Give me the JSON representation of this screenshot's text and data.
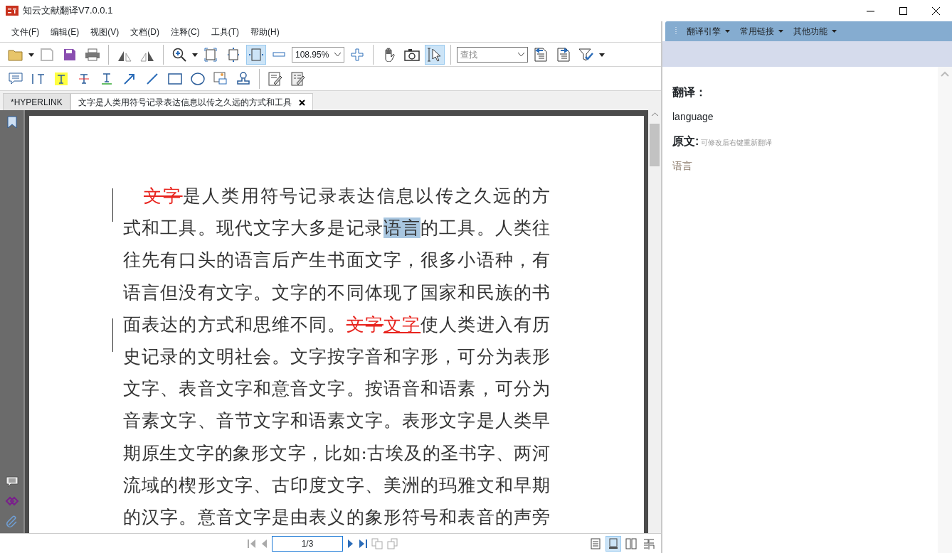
{
  "window": {
    "title": "知云文献翻译V7.0.0.1"
  },
  "menu": [
    "文件(F)",
    "编辑(E)",
    "视图(V)",
    "文档(D)",
    "注释(C)",
    "工具(T)",
    "帮助(H)"
  ],
  "toolbar": {
    "zoom_value": "108.95%",
    "search_placeholder": "查找",
    "fit_width_selected": true,
    "select_tool_selected": true
  },
  "tabs": [
    {
      "label": "*HYPERLINK",
      "selected": false,
      "closable": false
    },
    {
      "label": "文字是人类用符号记录表达信息以传之久远的方式和工具",
      "selected": true,
      "closable": true
    }
  ],
  "document": {
    "lines": [
      [
        {
          "text": "文字",
          "kind": "strike"
        },
        {
          "text": "是人类用符号记录表达信息以传之久远的方",
          "kind": "plain"
        }
      ],
      [
        {
          "text": "式和工具。现代文字大多是记录",
          "kind": "plain"
        },
        {
          "text": "语言",
          "kind": "highlight"
        },
        {
          "text": "的工具。人类往",
          "kind": "plain"
        }
      ],
      [
        {
          "text": "往先有口头的语言后产生书面文字，很多小语种，有",
          "kind": "plain"
        }
      ],
      [
        {
          "text": "语言但没有文字。文字的不同体现了国家和民族的书",
          "kind": "plain"
        }
      ],
      [
        {
          "text": "面表达的方式和思维不同。",
          "kind": "plain"
        },
        {
          "text": "文字",
          "kind": "strike"
        },
        {
          "text": "文字",
          "kind": "underline"
        },
        {
          "text": "使人类进入有历",
          "kind": "plain"
        }
      ],
      [
        {
          "text": "史记录的文明社会。文字按字音和字形，可分为表形",
          "kind": "plain"
        }
      ],
      [
        {
          "text": "文字、表音文字和意音文字。按语音和语素，可分为",
          "kind": "plain"
        }
      ],
      [
        {
          "text": "音素文字、音节文字和语素文字。表形文字是人类早",
          "kind": "plain"
        }
      ],
      [
        {
          "text": "期原生文字的象形文字，比如:古埃及的圣书字、两河",
          "kind": "plain"
        }
      ],
      [
        {
          "text": "流域的楔形文字、古印度文字、美洲的玛雅文和早期",
          "kind": "plain"
        }
      ],
      [
        {
          "text": "的汉字。意音文字是由表义的象形符号和表音的声旁",
          "kind": "plain"
        }
      ]
    ]
  },
  "pager": {
    "page": "1/3"
  },
  "view_modes": [
    {
      "selected": false
    },
    {
      "selected": true
    },
    {
      "selected": false
    },
    {
      "selected": false
    }
  ],
  "side_panel": {
    "menus": [
      "翻译引擎",
      "常用链接",
      "其他功能"
    ],
    "translation_heading": "翻译：",
    "translation": "language",
    "source_heading": "原文:",
    "source_hint": "可修改后右键重新翻译",
    "source": "语言"
  }
}
